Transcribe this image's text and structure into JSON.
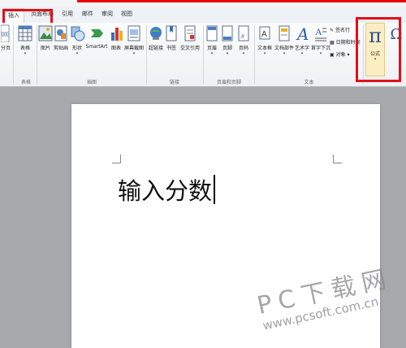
{
  "tabs": [
    {
      "label": "插入"
    },
    {
      "label": "页面布局"
    },
    {
      "label": "引用"
    },
    {
      "label": "邮件"
    },
    {
      "label": "审阅"
    },
    {
      "label": "视图"
    }
  ],
  "ribbon": {
    "tools": [
      {
        "label": "分页",
        "icon": "page-break-icon"
      },
      {
        "label": "表格",
        "icon": "table-icon"
      },
      {
        "label": "图片",
        "icon": "picture-icon"
      },
      {
        "label": "剪贴画",
        "icon": "clipart-icon"
      },
      {
        "label": "形状",
        "icon": "shapes-icon"
      },
      {
        "label": "SmartArt",
        "icon": "smartart-icon"
      },
      {
        "label": "图表",
        "icon": "chart-icon"
      },
      {
        "label": "屏幕截图",
        "icon": "screenshot-icon"
      },
      {
        "label": "超链接",
        "icon": "hyperlink-icon"
      },
      {
        "label": "书签",
        "icon": "bookmark-icon"
      },
      {
        "label": "交叉引用",
        "icon": "cross-reference-icon"
      },
      {
        "label": "页眉",
        "icon": "header-icon"
      },
      {
        "label": "页脚",
        "icon": "footer-icon"
      },
      {
        "label": "页码",
        "icon": "page-number-icon"
      },
      {
        "label": "文本框",
        "icon": "textbox-icon"
      },
      {
        "label": "文档部件",
        "icon": "quick-parts-icon"
      },
      {
        "label": "艺术字",
        "icon": "wordart-icon"
      },
      {
        "label": "首字下沉",
        "icon": "drop-cap-icon"
      },
      {
        "label": "公式",
        "icon": "pi-icon"
      }
    ],
    "small": {
      "signature": "签名行",
      "datetime": "日期和时间",
      "object": "对象"
    },
    "groups": {
      "tables": "表格",
      "illustrations": "插图",
      "links": "链接",
      "header_footer": "页眉和页脚",
      "text": "文本"
    },
    "partial_icon": "Ω"
  },
  "document": {
    "text": "输入分数"
  },
  "watermark": {
    "brand": "PC下载网",
    "url": "www.pcsoft.com.cn"
  },
  "colors": {
    "highlight": "#e0101a",
    "ribbon_bg": "#f6f7f9",
    "workspace": "#a7a9ad"
  }
}
